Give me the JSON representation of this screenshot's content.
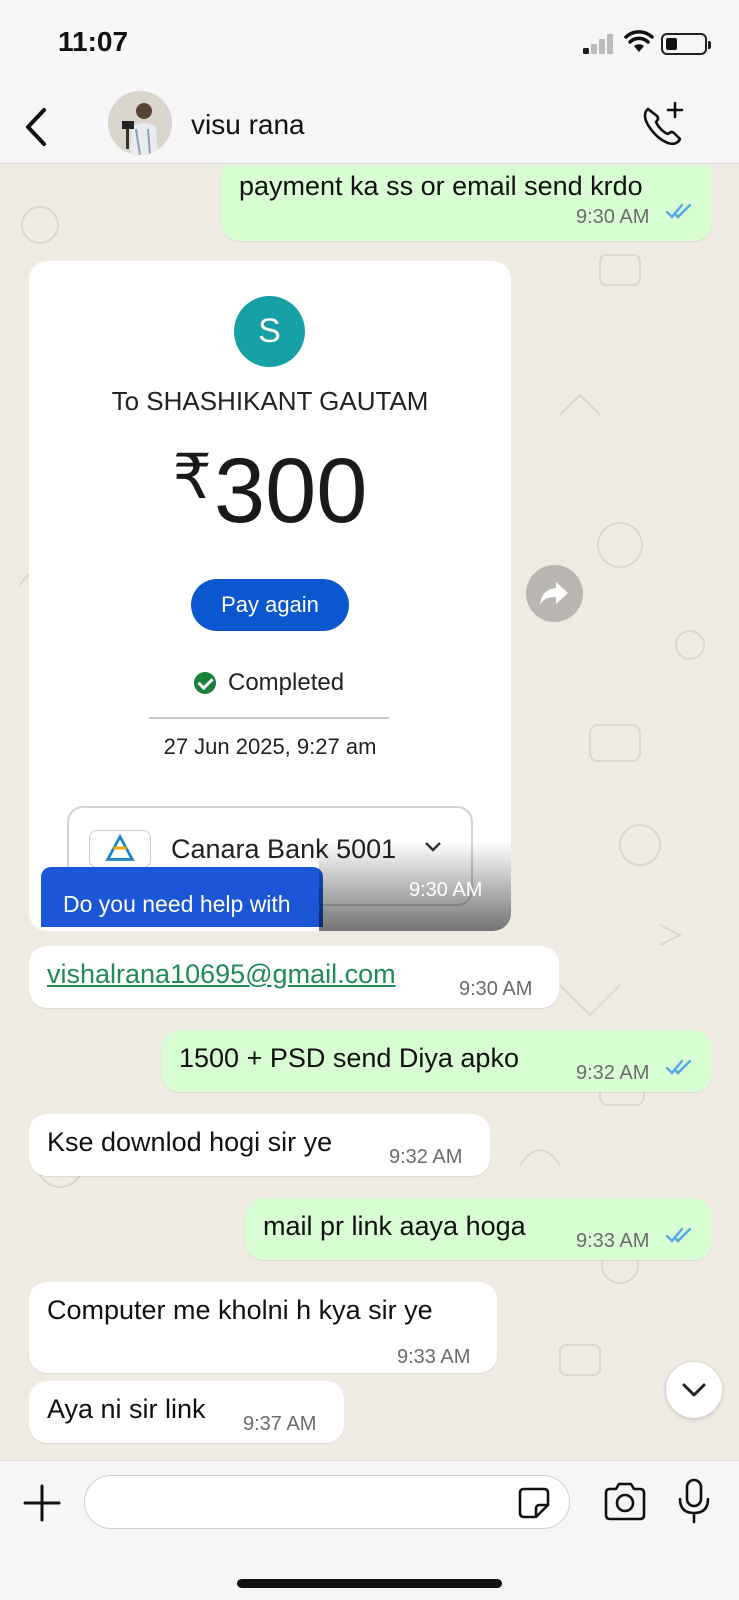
{
  "status_bar": {
    "time": "11:07"
  },
  "header": {
    "contact_name": "visu rana"
  },
  "messages": [
    {
      "text": "payment ka ss or email send krdo",
      "time": "9:30 AM"
    },
    {
      "time": "9:30 AM"
    },
    {
      "text": "vishalrana10695@gmail.com",
      "time": "9:30 AM"
    },
    {
      "text": "1500 + PSD send Diya apko",
      "time": "9:32 AM"
    },
    {
      "text": "Kse downlod hogi sir ye",
      "time": "9:32 AM"
    },
    {
      "text": "mail pr link aaya hoga",
      "time": "9:33 AM"
    },
    {
      "text": "Computer me kholni h kya sir ye",
      "time": "9:33 AM"
    },
    {
      "text": "Aya ni sir link",
      "time": "9:37 AM"
    }
  ],
  "payment_screenshot": {
    "avatar_letter": "S",
    "recipient": "To SHASHIKANT GAUTAM",
    "currency": "₹",
    "amount": "300",
    "button": "Pay again",
    "status": "Completed",
    "date": "27 Jun 2025, 9:27 am",
    "bank": "Canara Bank 5001",
    "help_text": "Do you need help with"
  },
  "composer": {
    "placeholder": ""
  },
  "colors": {
    "outgoing_bubble": "#d9fdd3",
    "incoming_bubble": "#ffffff",
    "tick_read": "#53a6e8",
    "link": "#1f8a5a",
    "chat_bg": "#efeae2"
  },
  "icons": [
    "back-chevron-icon",
    "add-call-icon",
    "read-receipt-icon",
    "forward-icon",
    "chevron-down-icon",
    "plus-icon",
    "sticker-icon",
    "camera-icon",
    "microphone-icon"
  ]
}
